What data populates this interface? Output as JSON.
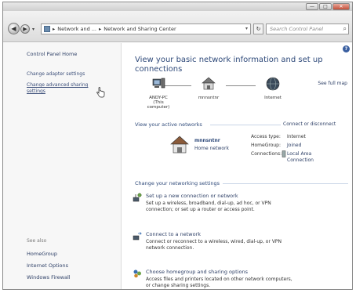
{
  "title_bar": {
    "minimize_label": "—",
    "maximize_label": "□",
    "close_label": "✕"
  },
  "nav": {
    "back_glyph": "◀",
    "forward_glyph": "▶",
    "dropdown_glyph": "▾"
  },
  "address": {
    "crumbs": [
      "Network and ...",
      "Network and Sharing Center"
    ],
    "separator": "▸",
    "dropdown_glyph": "▾"
  },
  "refresh_glyph": "↻",
  "search": {
    "placeholder": "Search Control Panel",
    "icon": "search-icon"
  },
  "left_pane": {
    "home": "Control Panel Home",
    "links": [
      "Change adapter settings",
      "Change advanced sharing",
      "settings"
    ],
    "see_also_label": "See also",
    "see_also": [
      "HomeGroup",
      "Internet Options",
      "Windows Firewall"
    ]
  },
  "main": {
    "help_glyph": "?",
    "heading_line1": "View your basic network information and set up",
    "heading_line2": "connections",
    "see_full_map": "See full map",
    "map": {
      "computer_name": "ANDY-PC",
      "computer_sub": "(This computer)",
      "router_name": "mnnsntnr",
      "internet_name": "Internet"
    },
    "active_section": {
      "title": "View your active networks",
      "right_link": "Connect or disconnect",
      "network_name": "mnnsntnr",
      "network_type": "Home network",
      "access_type_label": "Access type:",
      "access_type_value": "Internet",
      "homegroup_label": "HomeGroup:",
      "homegroup_value": "Joined",
      "connections_label": "Connections:",
      "connections_value_1": "Local Area",
      "connections_value_2": "Connection"
    },
    "change_section": {
      "title": "Change your networking settings",
      "tasks": [
        {
          "title": "Set up a new connection or network",
          "desc1": "Set up a wireless, broadband, dial-up, ad hoc, or VPN",
          "desc2": "connection; or set up a router or access point."
        },
        {
          "title": "Connect to a network",
          "desc1": "Connect or reconnect to a wireless, wired, dial-up, or VPN",
          "desc2": "network connection."
        },
        {
          "title": "Choose homegroup and sharing options",
          "desc1": "Access files and printers located on other network computers,",
          "desc2": "or change sharing settings."
        }
      ]
    }
  },
  "colors": {
    "link": "#2d3f66",
    "heading": "#2f4a7a",
    "left_pane_bg": "#f7f7f7"
  }
}
